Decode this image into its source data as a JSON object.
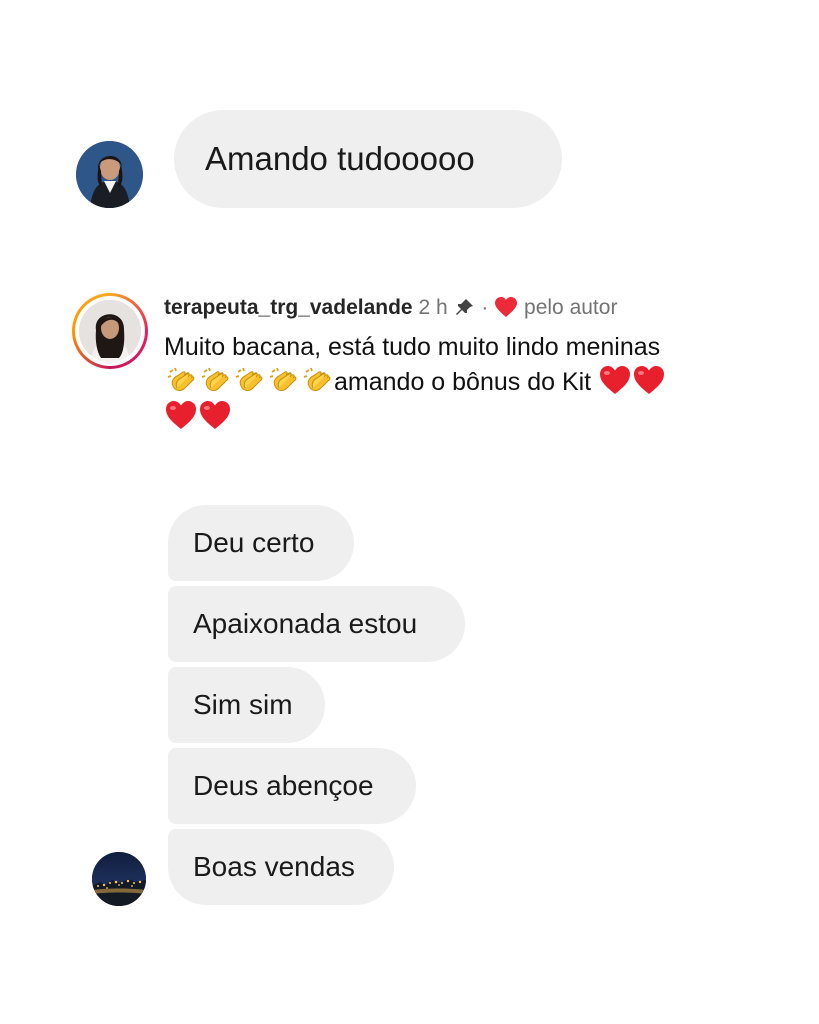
{
  "first_message": {
    "text": "Amando tudooooo"
  },
  "comment": {
    "username": "terapeuta_trg_vadelande",
    "time": "2 h",
    "separator": "·",
    "liked_by": "pelo autor",
    "line1": "Muito bacana,  está tudo muito lindo meninas",
    "line2_text": "amando o bônus do Kit",
    "icons": [
      "pin-icon",
      "heart-icon",
      "clapping-hands-icon",
      "red-heart-icon"
    ]
  },
  "messages": [
    {
      "text": "Deu certo"
    },
    {
      "text": "Apaixonada estou"
    },
    {
      "text": "Sim sim"
    },
    {
      "text": "Deus abençoe"
    },
    {
      "text": "Boas vendas"
    }
  ],
  "colors": {
    "bubble": "#efefef",
    "heart": "#ed2a3a",
    "meta": "#737373"
  }
}
